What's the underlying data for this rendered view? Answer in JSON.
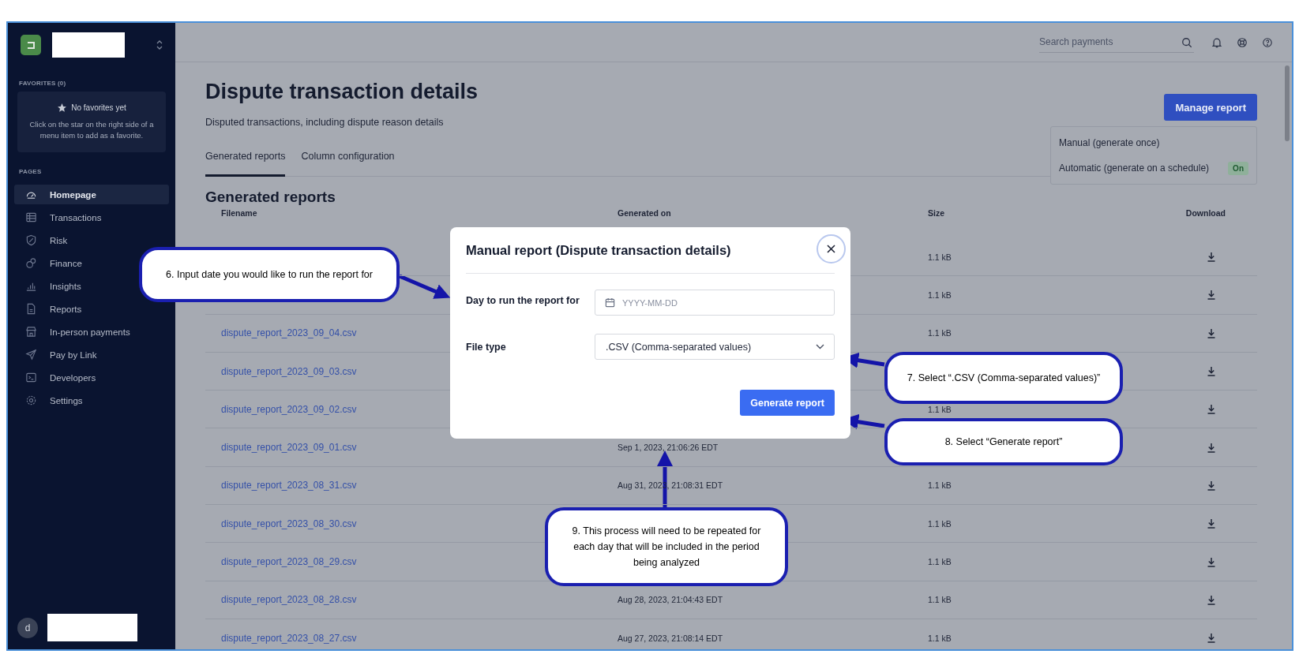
{
  "sidebar": {
    "favorites_heading": "FAVORITES (0)",
    "favorites_empty": {
      "title": "No favorites yet",
      "text": "Click on the star on the right side of a menu item to add as a favorite."
    },
    "pages_heading": "PAGES",
    "items": [
      {
        "label": "Homepage",
        "selected": true
      },
      {
        "label": "Transactions",
        "selected": false
      },
      {
        "label": "Risk",
        "selected": false
      },
      {
        "label": "Finance",
        "selected": false
      },
      {
        "label": "Insights",
        "selected": false
      },
      {
        "label": "Reports",
        "selected": false
      },
      {
        "label": "In-person payments",
        "selected": false
      },
      {
        "label": "Pay by Link",
        "selected": false
      },
      {
        "label": "Developers",
        "selected": false
      },
      {
        "label": "Settings",
        "selected": false
      }
    ],
    "avatar": "d"
  },
  "topbar": {
    "search": {
      "placeholder": "Search payments"
    }
  },
  "page": {
    "title": "Dispute transaction details",
    "subtitle": "Disputed transactions, including dispute reason details",
    "tabs": [
      {
        "label": "Generated reports",
        "selected": true
      },
      {
        "label": "Column configuration",
        "selected": false
      }
    ],
    "manage_button": "Manage report",
    "manage_menu": [
      {
        "label": "Manual (generate once)"
      },
      {
        "label": "Automatic (generate on a schedule)",
        "badge": "On"
      }
    ],
    "section_title": "Generated reports"
  },
  "table": {
    "columns": [
      "Filename",
      "Generated on",
      "Size",
      "Download"
    ],
    "rows": [
      {
        "size": "1.1 kB"
      },
      {
        "size": "1.1 kB"
      },
      {
        "filename": "dispute_report_2023_09_04.csv",
        "size": "1.1 kB"
      },
      {
        "filename": "dispute_report_2023_09_03.csv"
      },
      {
        "filename": "dispute_report_2023_09_02.csv",
        "size": "1.1 kB"
      },
      {
        "filename": "dispute_report_2023_09_01.csv",
        "generated_on": "Sep 1, 2023, 21:06:26 EDT"
      },
      {
        "filename": "dispute_report_2023_08_31.csv",
        "generated_on": "Aug 31, 2023, 21:08:31 EDT",
        "size": "1.1 kB"
      },
      {
        "filename": "dispute_report_2023_08_30.csv",
        "size": "1.1 kB"
      },
      {
        "filename": "dispute_report_2023_08_29.csv",
        "size": "1.1 kB"
      },
      {
        "filename": "dispute_report_2023_08_28.csv",
        "generated_on": "Aug 28, 2023, 21:04:43 EDT",
        "size": "1.1 kB"
      },
      {
        "filename": "dispute_report_2023_08_27.csv",
        "generated_on": "Aug 27, 2023, 21:08:14 EDT",
        "size": "1.1 kB"
      }
    ]
  },
  "modal": {
    "title": "Manual report (Dispute transaction details)",
    "date_label": "Day to run the report for",
    "date_field": {
      "placeholder": "YYYY-MM-DD"
    },
    "file_type_label": "File type",
    "file_type_value": ".CSV (Comma-separated values)",
    "button": "Generate report"
  },
  "callouts": [
    {
      "text": "6. Input date you would like to run the report for"
    },
    {
      "text": "7. Select “.CSV (Comma-separated values)”"
    },
    {
      "text": "8. Select “Generate report”"
    },
    {
      "text": "9. This process will need to be repeated for each day that will be included in the period being analyzed"
    }
  ]
}
